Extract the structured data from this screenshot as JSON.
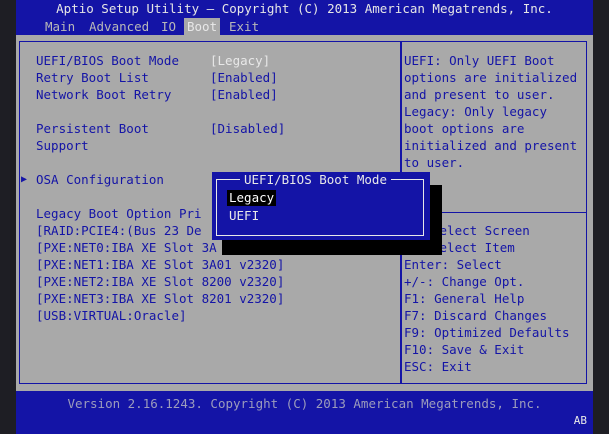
{
  "title": "Aptio Setup Utility – Copyright (C) 2013 American Megatrends, Inc.",
  "tabs": [
    "Main",
    "Advanced",
    "IO",
    "Boot",
    "Exit"
  ],
  "settings": {
    "boot_mode_label": "UEFI/BIOS Boot Mode",
    "boot_mode_value": "[Legacy]",
    "retry_label": "Retry Boot List",
    "retry_value": "[Enabled]",
    "network_label": "Network Boot Retry",
    "network_value": "[Enabled]",
    "persistent_label_1": "Persistent Boot",
    "persistent_label_2": "Support",
    "persistent_value": "[Disabled]",
    "osa_label": "OSA Configuration",
    "legacy_priority_label": "Legacy Boot Option Pri"
  },
  "boot_list": [
    "[RAID:PCIE4:(Bus 23 De",
    "[PXE:NET0:IBA XE Slot 3A",
    "[PXE:NET1:IBA XE Slot 3A01 v2320]",
    "[PXE:NET2:IBA XE Slot 8200 v2320]",
    "[PXE:NET3:IBA XE Slot 8201 v2320]",
    "[USB:VIRTUAL:Oracle]"
  ],
  "help_lines": [
    "UEFI: Only UEFI Boot",
    "options are initialized",
    "and present to user.",
    "Legacy: Only legacy",
    "boot options are",
    "initialized and present",
    "to user."
  ],
  "key_help": [
    "Select Screen",
    "Select Item",
    "Enter: Select",
    "+/-: Change Opt.",
    "F1: General Help",
    "F7: Discard Changes",
    "F9: Optimized Defaults",
    "F10: Save & Exit",
    "ESC: Exit"
  ],
  "popup": {
    "title": "UEFI/BIOS Boot Mode",
    "options": [
      "Legacy",
      "UEFI"
    ]
  },
  "footer": "Version 2.16.1243. Copyright (C) 2013 American Megatrends, Inc.",
  "badge": "AB",
  "colors": {
    "bios_blue": "#1414a6",
    "panel_grey": "#a9a9a9",
    "text_white": "#e8e8e8"
  }
}
